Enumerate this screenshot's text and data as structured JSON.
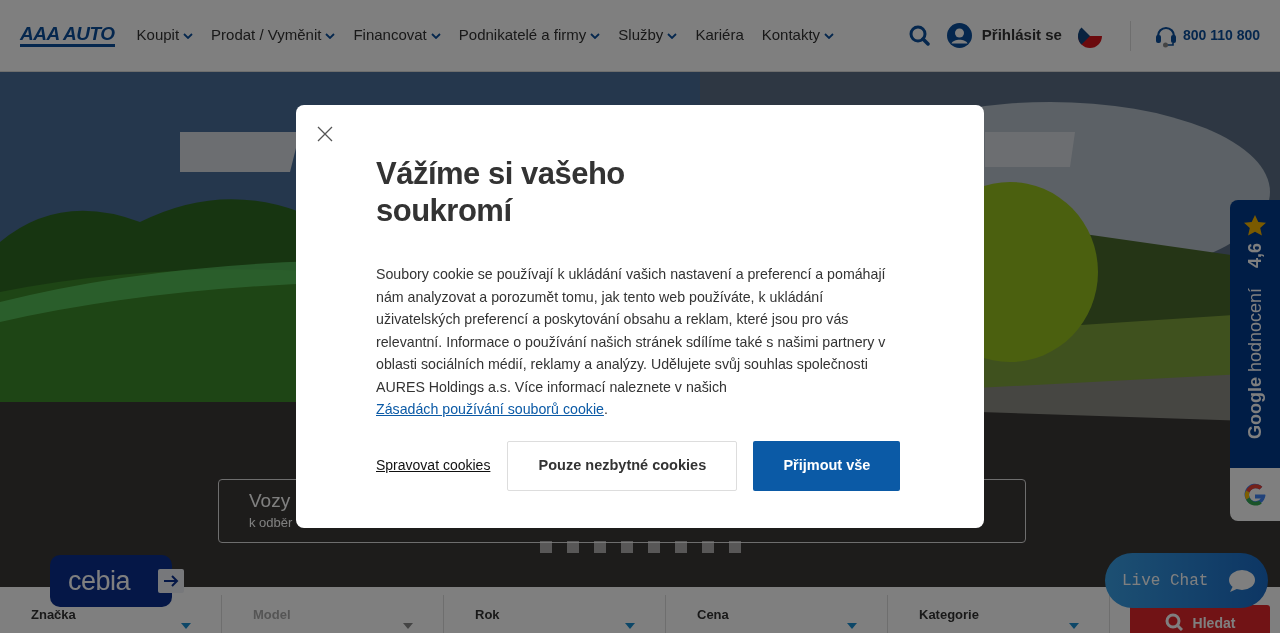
{
  "header": {
    "logo": "AAA AUTO",
    "nav": [
      {
        "label": "Koupit",
        "dropdown": true
      },
      {
        "label": "Prodat / Vyměnit",
        "dropdown": true
      },
      {
        "label": "Financovat",
        "dropdown": true
      },
      {
        "label": "Podnikatelé a firmy",
        "dropdown": true
      },
      {
        "label": "Služby",
        "dropdown": true
      },
      {
        "label": "Kariéra",
        "dropdown": false
      },
      {
        "label": "Kontakty",
        "dropdown": true
      }
    ],
    "login": "Přihlásit se",
    "phone": "800 110 800"
  },
  "hero": {
    "banner": {
      "title": "Vozy",
      "subtitle": "k odběr"
    },
    "dots": [
      {
        "selected": false
      },
      {
        "selected": false
      },
      {
        "selected": false
      },
      {
        "selected": false
      },
      {
        "selected": false
      },
      {
        "selected": false
      },
      {
        "selected": false
      },
      {
        "selected": false
      }
    ]
  },
  "filters": [
    {
      "label": "Značka",
      "disabled": false
    },
    {
      "label": "Model",
      "disabled": true
    },
    {
      "label": "Rok",
      "disabled": false
    },
    {
      "label": "Cena",
      "disabled": false
    },
    {
      "label": "Kategorie",
      "disabled": false
    }
  ],
  "search_button": "Hledat",
  "cebia": "cebia",
  "rating": {
    "brand": "Google",
    "label": "hodnocení",
    "score": "4,6"
  },
  "chat": "Live Chat",
  "cookie_dialog": {
    "title": "Vážíme si vašeho soukromí",
    "text": "Soubory cookie se používají k ukládání vašich nastavení a preferencí a pomáhají nám analyzovat a porozumět tomu, jak tento web používáte, k ukládání uživatelských preferencí a poskytování obsahu a reklam, které jsou pro vás relevantní. Informace o používání našich stránek sdílíme také s našimi partnery v oblasti sociálních médií, reklamy a analýzy. Udělujete svůj souhlas společnosti AURES Holdings a.s. Více informací naleznete v našich ",
    "link": "Zásadách používání souborů cookie",
    "text_end": ".",
    "buttons": [
      {
        "label": "Spravovat cookies",
        "kind": "link"
      },
      {
        "label": "Pouze nezbytné cookies",
        "kind": "secondary"
      },
      {
        "label": "Přijmout vše",
        "kind": "primary"
      }
    ]
  }
}
